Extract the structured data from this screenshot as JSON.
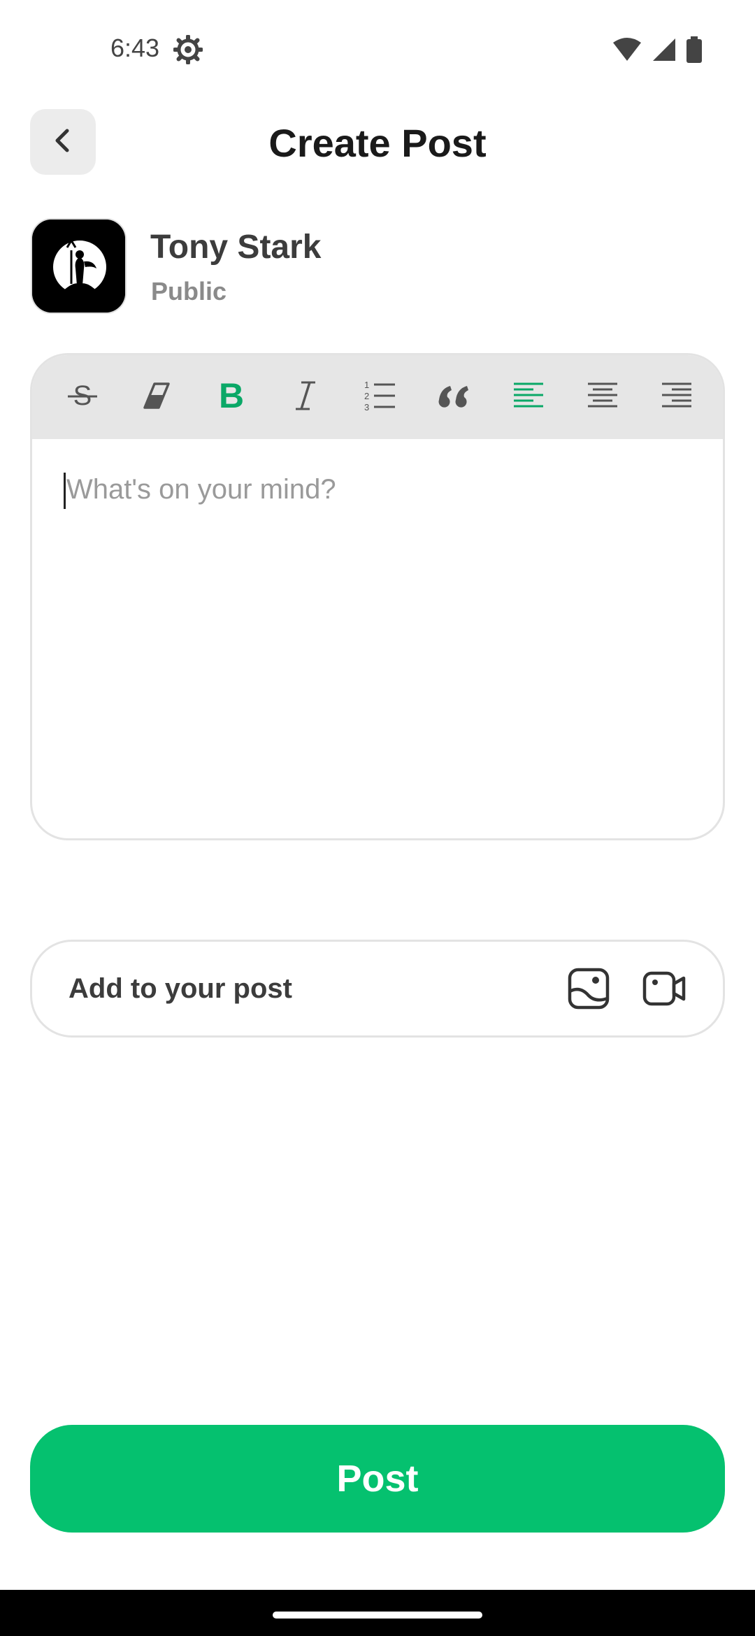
{
  "status_bar": {
    "time": "6:43",
    "icons": [
      "gear-icon",
      "wifi-icon",
      "signal-icon",
      "battery-icon"
    ]
  },
  "header": {
    "title": "Create Post",
    "back_icon": "chevron-left-icon"
  },
  "user": {
    "name": "Tony Stark",
    "privacy": "Public"
  },
  "editor": {
    "placeholder": "What's on your mind?",
    "value": "",
    "toolbar": [
      {
        "name": "strikethrough",
        "icon": "strikethrough-icon",
        "active": false
      },
      {
        "name": "clear-format",
        "icon": "eraser-icon",
        "active": false
      },
      {
        "name": "bold",
        "icon": "bold-icon",
        "active": true
      },
      {
        "name": "italic",
        "icon": "italic-icon",
        "active": false
      },
      {
        "name": "ordered-list",
        "icon": "ordered-list-icon",
        "active": false
      },
      {
        "name": "quote",
        "icon": "quote-icon",
        "active": false
      },
      {
        "name": "align-left",
        "icon": "align-left-icon",
        "active": true
      },
      {
        "name": "align-center",
        "icon": "align-center-icon",
        "active": false
      },
      {
        "name": "align-right",
        "icon": "align-right-icon",
        "active": false
      }
    ]
  },
  "add_to_post": {
    "label": "Add to your post",
    "icons": [
      "image-icon",
      "video-icon"
    ]
  },
  "post_button": {
    "label": "Post"
  },
  "colors": {
    "accent": "#05c16f",
    "active_tool": "#0aa867",
    "tool_inactive": "#555555",
    "toolbar_bg": "#e6e6e6"
  }
}
